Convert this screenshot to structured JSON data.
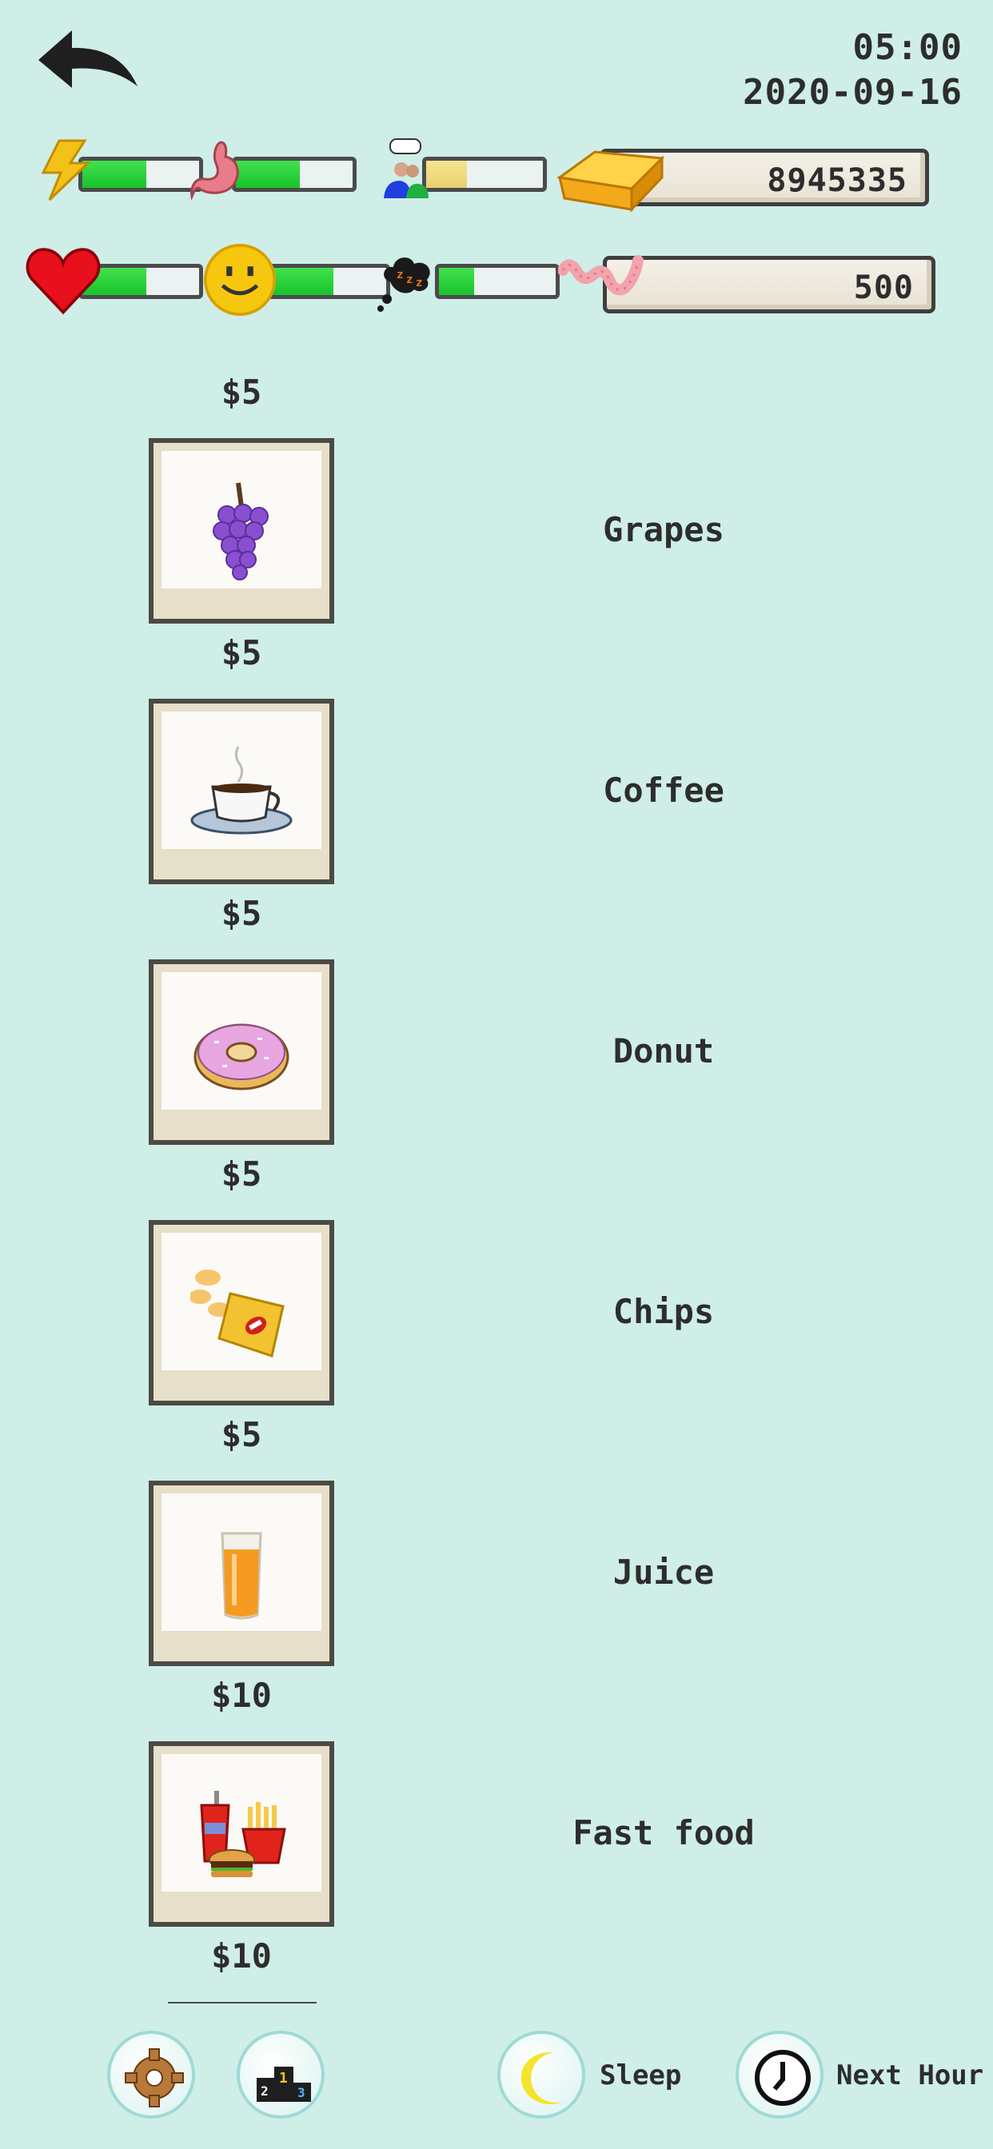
{
  "header": {
    "time": "05:00",
    "date": "2020-09-16"
  },
  "stats": {
    "energy": 0.55,
    "hunger": 0.55,
    "social": 0.35,
    "health": 0.55,
    "happiness": 0.55,
    "sleep": 0.3
  },
  "resources": {
    "gold_value": "8945335",
    "worm_value": "500"
  },
  "items": [
    {
      "price": "$5",
      "name": "Grapes",
      "icon": "grapes-icon"
    },
    {
      "price": "$5",
      "name": "Coffee",
      "icon": "coffee-icon"
    },
    {
      "price": "$5",
      "name": "Donut",
      "icon": "donut-icon"
    },
    {
      "price": "$5",
      "name": "Chips",
      "icon": "chips-icon"
    },
    {
      "price": "$5",
      "name": "Juice",
      "icon": "juice-icon"
    },
    {
      "price": "$10",
      "name": "Fast food",
      "icon": "fast-food-icon"
    },
    {
      "price": "$10"
    }
  ],
  "bottom_bar": {
    "sleep_label": "Sleep",
    "next_hour_label": "Next Hour"
  },
  "colors": {
    "background": "#cfeee8",
    "bar_fill": "#17c42a",
    "social_fill": "#e9d070"
  }
}
